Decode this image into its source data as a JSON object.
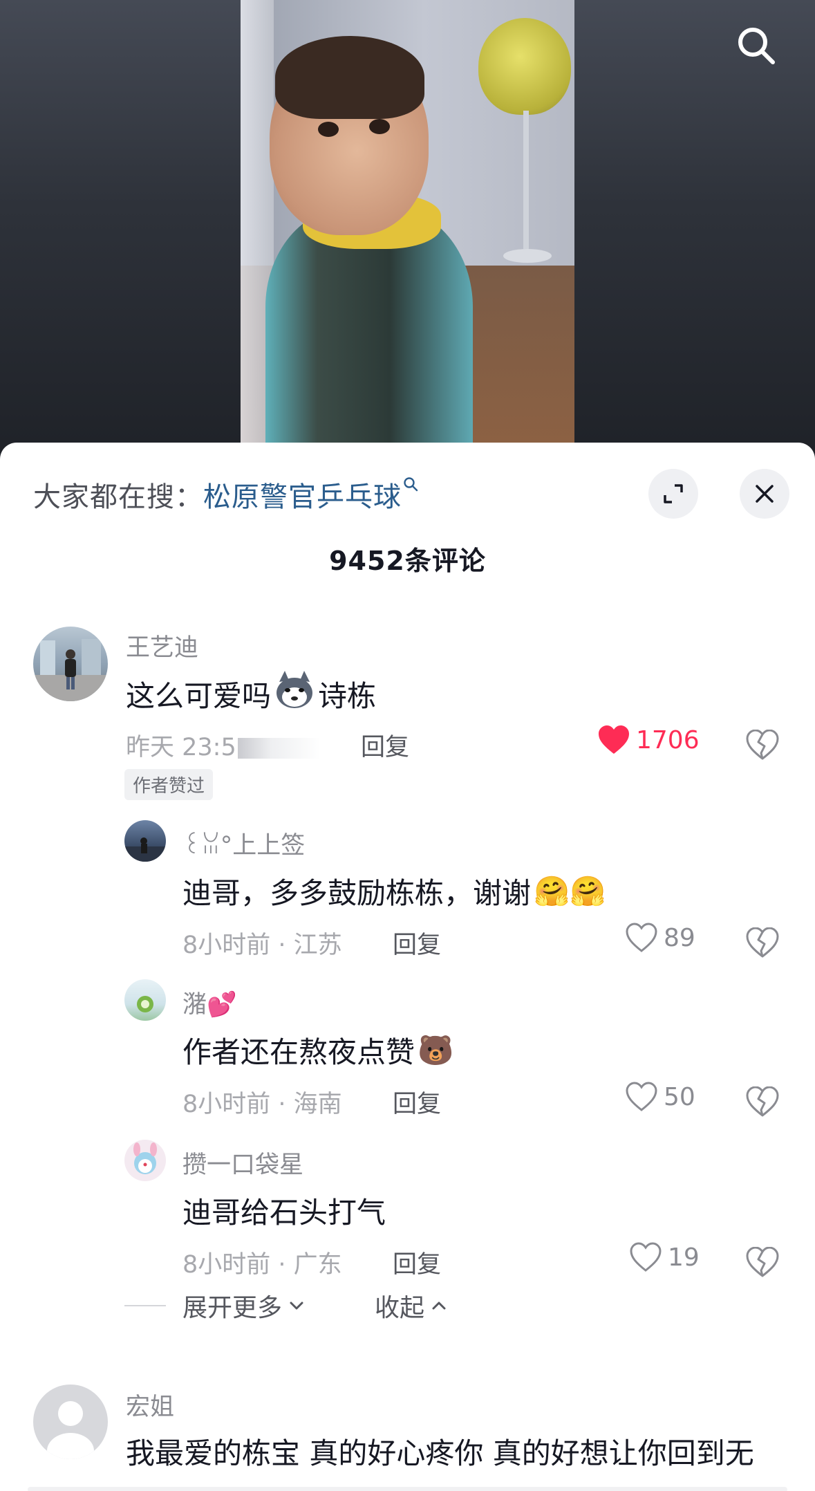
{
  "top_bar": {
    "search_icon": "search-icon"
  },
  "sheet": {
    "hot_search_prefix": "大家都在搜：",
    "hot_search_term": "松原警官乒乓球",
    "expand_icon": "expand-icon",
    "close_icon": "close-icon",
    "comment_count": "9452条评论"
  },
  "comments": [
    {
      "user": "王艺迪",
      "text_before": "这么可爱吗",
      "text_after": "诗栋",
      "time": "昨天 23:5",
      "reply_label": "回复",
      "likes": "1706",
      "liked": true,
      "badge": "作者赞过"
    },
    {
      "user": "꒰ꈍ°上上签",
      "text": "迪哥，多多鼓励栋栋，谢谢",
      "emoji": "🤗🤗",
      "time": "8小时前 · 江苏",
      "reply_label": "回复",
      "likes": "89"
    },
    {
      "user": "潴",
      "user_emoji": "💕",
      "text": "作者还在熬夜点赞",
      "emoji": "🐻",
      "time": "8小时前 · 海南",
      "reply_label": "回复",
      "likes": "50"
    },
    {
      "user": "攒一口袋星",
      "text": "迪哥给石头打气",
      "time": "8小时前 · 广东",
      "reply_label": "回复",
      "likes": "19"
    },
    {
      "user": "宏姐",
      "text": "我最爱的栋宝 真的好心疼你 真的好想让你回到无"
    }
  ],
  "thread_controls": {
    "expand_label": "展开更多",
    "collapse_label": "收起"
  },
  "colors": {
    "accent_like": "#fe2c55",
    "link": "#2b5d8d"
  }
}
